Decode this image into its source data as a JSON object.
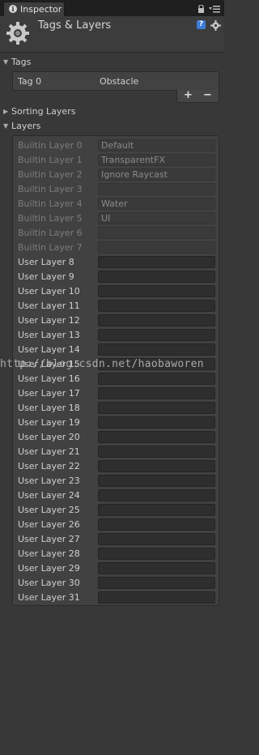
{
  "tabbar": {
    "tab_label": "Inspector",
    "tab_icon": "i"
  },
  "header": {
    "title": "Tags & Layers",
    "help_icon": "?"
  },
  "tags": {
    "section_label": "Tags",
    "items": [
      {
        "name": "Tag 0",
        "value": "Obstacle"
      }
    ],
    "add_label": "+",
    "remove_label": "−"
  },
  "sorting_layers": {
    "section_label": "Sorting Layers"
  },
  "layers": {
    "section_label": "Layers",
    "items": [
      {
        "label": "Builtin Layer 0",
        "value": "Default"
      },
      {
        "label": "Builtin Layer 1",
        "value": "TransparentFX"
      },
      {
        "label": "Builtin Layer 2",
        "value": "Ignore Raycast"
      },
      {
        "label": "Builtin Layer 3",
        "value": ""
      },
      {
        "label": "Builtin Layer 4",
        "value": "Water"
      },
      {
        "label": "Builtin Layer 5",
        "value": "UI"
      },
      {
        "label": "Builtin Layer 6",
        "value": ""
      },
      {
        "label": "Builtin Layer 7",
        "value": ""
      },
      {
        "label": "User Layer 8",
        "value": ""
      },
      {
        "label": "User Layer 9",
        "value": ""
      },
      {
        "label": "User Layer 10",
        "value": ""
      },
      {
        "label": "User Layer 11",
        "value": ""
      },
      {
        "label": "User Layer 12",
        "value": ""
      },
      {
        "label": "User Layer 13",
        "value": ""
      },
      {
        "label": "User Layer 14",
        "value": ""
      },
      {
        "label": "User Layer 15",
        "value": ""
      },
      {
        "label": "User Layer 16",
        "value": ""
      },
      {
        "label": "User Layer 17",
        "value": ""
      },
      {
        "label": "User Layer 18",
        "value": ""
      },
      {
        "label": "User Layer 19",
        "value": ""
      },
      {
        "label": "User Layer 20",
        "value": ""
      },
      {
        "label": "User Layer 21",
        "value": ""
      },
      {
        "label": "User Layer 22",
        "value": ""
      },
      {
        "label": "User Layer 23",
        "value": ""
      },
      {
        "label": "User Layer 24",
        "value": ""
      },
      {
        "label": "User Layer 25",
        "value": ""
      },
      {
        "label": "User Layer 26",
        "value": ""
      },
      {
        "label": "User Layer 27",
        "value": ""
      },
      {
        "label": "User Layer 28",
        "value": ""
      },
      {
        "label": "User Layer 29",
        "value": ""
      },
      {
        "label": "User Layer 30",
        "value": ""
      },
      {
        "label": "User Layer 31",
        "value": ""
      }
    ]
  },
  "watermark": {
    "text": "http://blog.csdn.net/haobaworen"
  }
}
